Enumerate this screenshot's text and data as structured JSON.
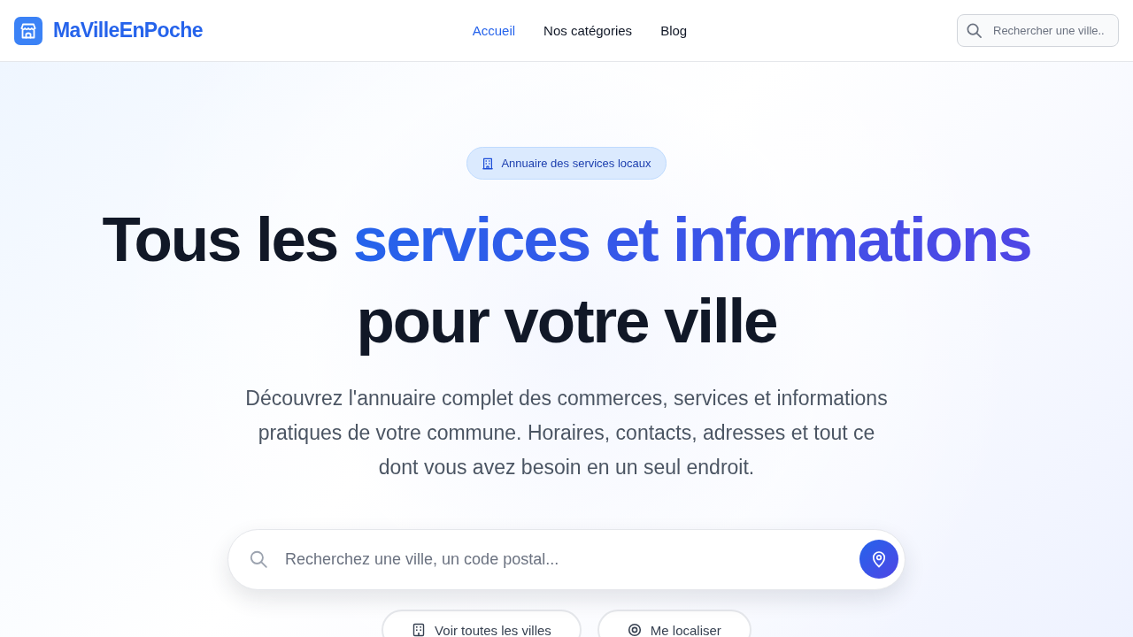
{
  "header": {
    "brand": "MaVilleEnPoche",
    "nav": [
      {
        "label": "Accueil",
        "selected": true
      },
      {
        "label": "Nos catégories",
        "selected": false
      },
      {
        "label": "Blog",
        "selected": false
      }
    ],
    "search": {
      "placeholder": "Rechercher une ville.."
    }
  },
  "hero": {
    "badge": "Annuaire des services locaux",
    "title": [
      {
        "text": "Tous les",
        "highlight": false
      },
      {
        "text": "services et informations",
        "highlight": true
      },
      {
        "text": "pour votre ville",
        "highlight": false
      }
    ],
    "subtitle": "Découvrez l'annuaire complet des commerces, services et informations pratiques de votre commune. Horaires, contacts, adresses et tout ce dont vous avez besoin en un seul endroit.",
    "search": {
      "placeholder": "Recherchez une ville, un code postal..."
    },
    "actions": [
      {
        "label": "Voir toutes les villes",
        "kind": "cities"
      },
      {
        "label": "Me localiser",
        "kind": "locate"
      }
    ]
  }
}
